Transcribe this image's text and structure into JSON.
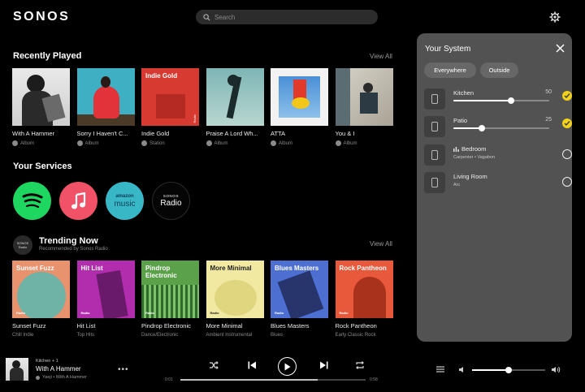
{
  "app": {
    "logo": "SONOS"
  },
  "search": {
    "placeholder": "Search"
  },
  "recently_played": {
    "title": "Recently Played",
    "view_all": "View All",
    "items": [
      {
        "title": "With A Hammer",
        "sub": "Album",
        "art_label": "",
        "art_tag": ""
      },
      {
        "title": "Sorry I Haven't C...",
        "sub": "Album",
        "art_label": "",
        "art_tag": ""
      },
      {
        "title": "Indie Gold",
        "sub": "Station",
        "art_label": "Indie Gold",
        "art_tag": "Radio"
      },
      {
        "title": "Praise A Lord Wh...",
        "sub": "Album",
        "art_label": "",
        "art_tag": ""
      },
      {
        "title": "ATTA",
        "sub": "Album",
        "art_label": "",
        "art_tag": ""
      },
      {
        "title": "You & I",
        "sub": "Album",
        "art_label": "",
        "art_tag": ""
      }
    ]
  },
  "services": {
    "title": "Your Services",
    "amazon_top": "amazon",
    "amazon_bottom": "music",
    "sonos_top": "SONOS",
    "sonos_bottom": "Radio"
  },
  "trending": {
    "title": "Trending Now",
    "subtitle": "Recommended by Sonos Radio",
    "view_all": "View All",
    "icon_top": "SONOS",
    "icon_bottom": "Radio",
    "items": [
      {
        "title": "Sunset Fuzz",
        "sub": "Chill Indie",
        "art_label": "Sunset Fuzz",
        "art_tag": "Radio"
      },
      {
        "title": "Hit List",
        "sub": "Top Hits",
        "art_label": "Hit List",
        "art_tag": "Radio"
      },
      {
        "title": "Pindrop Electronic",
        "sub": "Dance/Electronic",
        "art_label": "Pindrop Electronic",
        "art_tag": "Radio"
      },
      {
        "title": "More Minimal",
        "sub": "Ambient Instrumental",
        "art_label": "More Minimal",
        "art_tag": "Radio"
      },
      {
        "title": "Blues Masters",
        "sub": "Blues",
        "art_label": "Blues Masters",
        "art_tag": "Radio"
      },
      {
        "title": "Rock Pantheon",
        "sub": "Early Classic Rock",
        "art_label": "Rock Pantheon",
        "art_tag": "Radio"
      }
    ]
  },
  "system_panel": {
    "title": "Your System",
    "chips": [
      "Everywhere",
      "Outside"
    ],
    "rooms": [
      {
        "name": "Kitchen",
        "volume": "50",
        "level": 0.5,
        "selected": true
      },
      {
        "name": "Patio",
        "volume": "25",
        "level": 0.25,
        "selected": true
      },
      {
        "name": "Bedroom",
        "sub": "Carpenter • Vagabon",
        "selected": false
      },
      {
        "name": "Living Room",
        "sub": "Arc",
        "selected": false
      }
    ]
  },
  "now_playing": {
    "room": "Kitchen + 1",
    "track": "With A Hammer",
    "sub": "Yaeji • With A Hammer",
    "elapsed": "0:01",
    "total": "0:58",
    "progress": 0.74,
    "volume": 0.5
  },
  "colors": {
    "accent": "#f2d11c",
    "panel": "#525252"
  }
}
